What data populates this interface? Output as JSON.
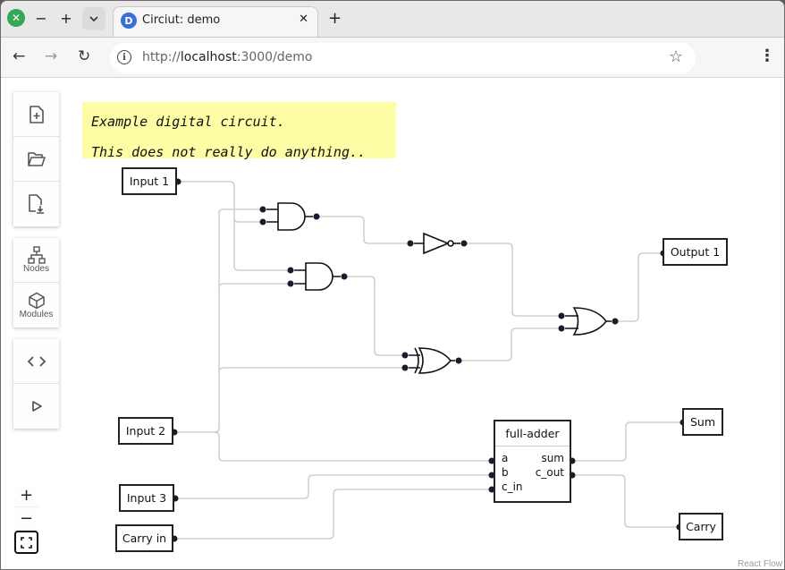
{
  "browser": {
    "tab_title": "Circiut: demo",
    "favicon_letter": "D",
    "tab_close": "✕",
    "new_tab": "+",
    "window_minimize": "−",
    "window_maximize": "+",
    "window_close": "✕",
    "tab_dropdown": "⌄",
    "url_scheme": "http://",
    "url_host": "localhost",
    "url_rest": ":3000/demo",
    "back": "←",
    "forward": "→",
    "reload": "↻",
    "star": "☆",
    "menu": "⋮",
    "info": "i"
  },
  "sidebar": {
    "file_group": [
      {
        "name": "new-file",
        "icon": "file-plus-icon"
      },
      {
        "name": "open-file",
        "icon": "folder-open-icon"
      },
      {
        "name": "download-file",
        "icon": "file-download-icon"
      }
    ],
    "panel_group": [
      {
        "label": "Nodes",
        "icon": "sitemap-icon"
      },
      {
        "label": "Modules",
        "icon": "cube-icon"
      }
    ],
    "code_group": [
      {
        "name": "code",
        "icon": "code-icon"
      },
      {
        "name": "run",
        "icon": "play-icon"
      }
    ]
  },
  "zoom_controls": {
    "zoom_in": "+",
    "zoom_out": "−"
  },
  "note": {
    "line1": "Example digital circuit.",
    "line2": "This does not really do anything.."
  },
  "nodes": {
    "input1": "Input 1",
    "input2": "Input 2",
    "input3": "Input 3",
    "carry_in": "Carry in",
    "output1": "Output 1",
    "sum": "Sum",
    "carry": "Carry",
    "full_adder": {
      "title": "full-adder",
      "inputs": [
        "a",
        "b",
        "c_in"
      ],
      "outputs": [
        "sum",
        "c_out"
      ]
    },
    "gates": [
      "AND",
      "AND",
      "NOT",
      "XOR",
      "OR"
    ]
  },
  "attribution": "React Flow"
}
